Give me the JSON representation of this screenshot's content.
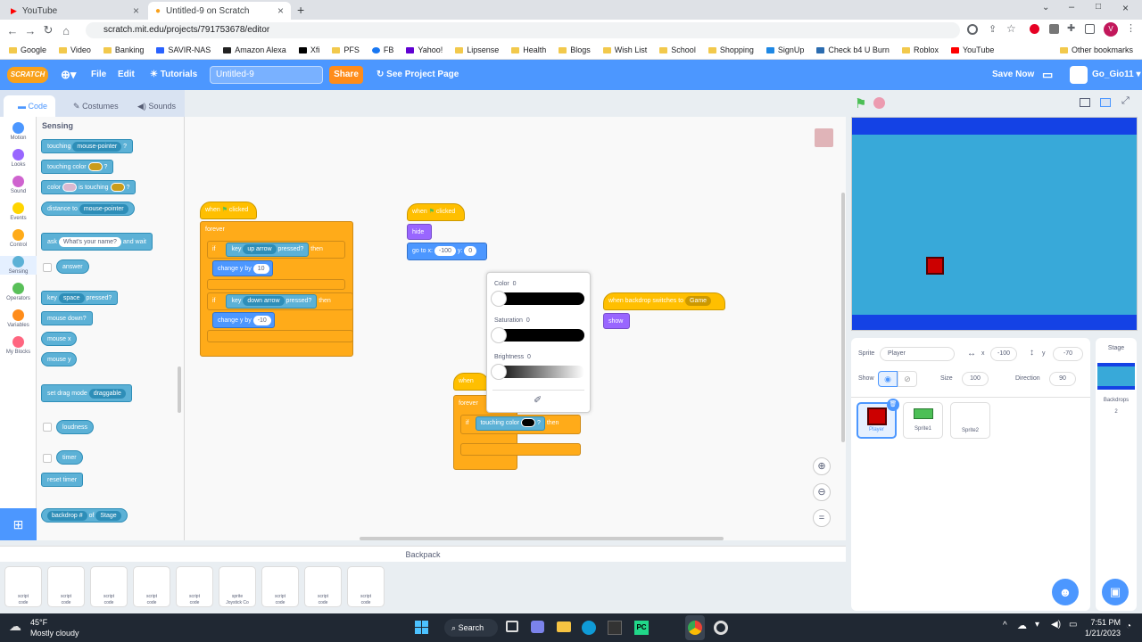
{
  "browser": {
    "tabs": [
      {
        "label": "YouTube"
      },
      {
        "label": "Untitled-9 on Scratch"
      }
    ],
    "url": "scratch.mit.edu/projects/791753678/editor",
    "bookmarks": [
      "Google",
      "Video",
      "Banking",
      "SAVIR-NAS",
      "Amazon Alexa",
      "Xfi",
      "PFS",
      "FB",
      "Yahoo!",
      "Lipsense",
      "Health",
      "Blogs",
      "Wish List",
      "School",
      "Shopping",
      "SignUp",
      "Check b4 U Burn",
      "Roblox",
      "YouTube"
    ],
    "other_bookmarks": "Other bookmarks",
    "profile_initial": "V"
  },
  "menu": {
    "logo": "SCRATCH",
    "file": "File",
    "edit": "Edit",
    "tutorials": "Tutorials",
    "project_title": "Untitled-9",
    "share": "Share",
    "see_project": "See Project Page",
    "save_now": "Save Now",
    "username": "Go_Gio11"
  },
  "editor_tabs": {
    "code": "Code",
    "costumes": "Costumes",
    "sounds": "Sounds"
  },
  "categories": [
    {
      "label": "Motion",
      "color": "#4c97ff"
    },
    {
      "label": "Looks",
      "color": "#9966ff"
    },
    {
      "label": "Sound",
      "color": "#cf63cf"
    },
    {
      "label": "Events",
      "color": "#ffd500"
    },
    {
      "label": "Control",
      "color": "#ffab19"
    },
    {
      "label": "Sensing",
      "color": "#5cb1d6"
    },
    {
      "label": "Operators",
      "color": "#59c059"
    },
    {
      "label": "Variables",
      "color": "#ff8c1a"
    },
    {
      "label": "My Blocks",
      "color": "#ff6680"
    }
  ],
  "palette": {
    "title": "Sensing",
    "touching": "touching",
    "mouse_pointer": "mouse-pointer",
    "q": "?",
    "touching_color": "touching color",
    "color_word": "color",
    "is_touching": "is touching",
    "distance_to": "distance to",
    "ask": "ask",
    "ask_default": "What's your name?",
    "and_wait": "and wait",
    "answer": "answer",
    "key": "key",
    "space": "space",
    "pressed": "pressed?",
    "mouse_down": "mouse down?",
    "mouse_x": "mouse x",
    "mouse_y": "mouse y",
    "set_drag": "set drag mode",
    "draggable": "draggable",
    "loudness": "loudness",
    "timer": "timer",
    "reset_timer": "reset timer",
    "backdrop_num": "backdrop #",
    "of": "of",
    "stage": "Stage"
  },
  "scripts": {
    "when": "when",
    "clicked": "clicked",
    "forever": "forever",
    "if": "if",
    "then": "then",
    "key": "key",
    "up_arrow": "up arrow",
    "down_arrow": "down arrow",
    "pressed": "pressed?",
    "change_y": "change y by",
    "ten": "10",
    "neg_ten": "-10",
    "hide": "hide",
    "go_to_x": "go to x:",
    "x_val": "-100",
    "y_lbl": "y:",
    "y_val": "0",
    "when_backdrop": "when backdrop switches to",
    "game": "Game",
    "show": "show",
    "touching_color": "touching color",
    "q": "?"
  },
  "color_picker": {
    "color_label": "Color",
    "color_val": "0",
    "saturation_label": "Saturation",
    "saturation_val": "0",
    "brightness_label": "Brightness",
    "brightness_val": "0"
  },
  "sprite_info": {
    "sprite_label": "Sprite",
    "sprite_name": "Player",
    "x_label": "x",
    "x_val": "-100",
    "y_label": "y",
    "y_val": "-70",
    "show_label": "Show",
    "size_label": "Size",
    "size_val": "100",
    "direction_label": "Direction",
    "direction_val": "90"
  },
  "sprites": [
    {
      "name": "Player"
    },
    {
      "name": "Sprite1"
    },
    {
      "name": "Sprite2"
    }
  ],
  "stage_pane": {
    "title": "Stage",
    "backdrops_label": "Backdrops",
    "backdrops_count": "2"
  },
  "backpack": {
    "title": "Backpack",
    "items": [
      {
        "l1": "script",
        "l2": "code"
      },
      {
        "l1": "script",
        "l2": "code"
      },
      {
        "l1": "script",
        "l2": "code"
      },
      {
        "l1": "script",
        "l2": "code"
      },
      {
        "l1": "script",
        "l2": "code"
      },
      {
        "l1": "sprite",
        "l2": "Joystick Co"
      },
      {
        "l1": "script",
        "l2": "code"
      },
      {
        "l1": "script",
        "l2": "code"
      },
      {
        "l1": "script",
        "l2": "code"
      }
    ]
  },
  "taskbar": {
    "temp": "45°F",
    "weather": "Mostly cloudy",
    "search": "Search",
    "time": "7:51 PM",
    "date": "1/21/2023"
  }
}
